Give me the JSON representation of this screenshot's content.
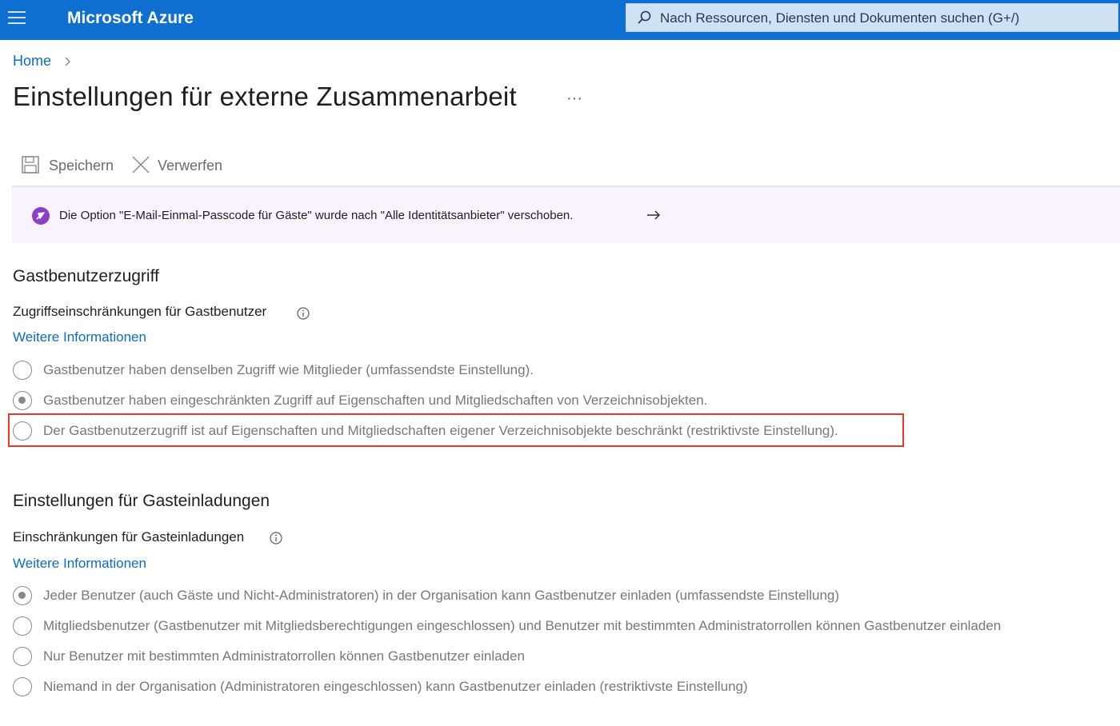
{
  "topbar": {
    "brand": "Microsoft Azure",
    "search_text": "Nach Ressourcen, Diensten und Dokumenten suchen (G+/)",
    "colors": {
      "bar": "#0f6fd0",
      "search_bg": "#cfe2f3"
    }
  },
  "breadcrumb": {
    "home": "Home"
  },
  "page": {
    "title": "Einstellungen für externe Zusammenarbeit",
    "more": "···"
  },
  "toolbar": {
    "save_label": "Speichern",
    "discard_label": "Verwerfen"
  },
  "banner": {
    "text": "Die Option \"E-Mail-Einmal-Passcode für Gäste\" wurde nach \"Alle Identitätsanbieter\" verschoben.",
    "icon": "rocket-icon",
    "colors": {
      "bg": "#f8f3fc",
      "icon": "#8a3fc7"
    }
  },
  "guest_access": {
    "title": "Gastbenutzerzugriff",
    "subheading": "Zugriffseinschränkungen für Gastbenutzer",
    "learn_more": "Weitere Informationen",
    "options": [
      {
        "label": "Gastbenutzer haben denselben Zugriff wie Mitglieder (umfassendste Einstellung).",
        "checked": false
      },
      {
        "label": "Gastbenutzer haben eingeschränkten Zugriff auf Eigenschaften und Mitgliedschaften von Verzeichnisobjekten.",
        "checked": true
      },
      {
        "label": "Der Gastbenutzerzugriff ist auf Eigenschaften und Mitgliedschaften eigener Verzeichnisobjekte beschränkt (restriktivste Einstellung).",
        "checked": false,
        "highlighted": true
      }
    ]
  },
  "guest_invites": {
    "title": "Einstellungen für Gasteinladungen",
    "subheading": "Einschränkungen für Gasteinladungen",
    "learn_more": "Weitere Informationen",
    "options": [
      {
        "label": "Jeder Benutzer (auch Gäste und Nicht-Administratoren) in der Organisation kann Gastbenutzer einladen (umfassendste Einstellung)",
        "checked": true
      },
      {
        "label": "Mitgliedsbenutzer (Gastbenutzer mit Mitgliedsberechtigungen eingeschlossen) und Benutzer mit bestimmten Administratorrollen können Gastbenutzer einladen",
        "checked": false
      },
      {
        "label": "Nur Benutzer mit bestimmten Administratorrollen können Gastbenutzer einladen",
        "checked": false
      },
      {
        "label": "Niemand in der Organisation (Administratoren eingeschlossen) kann Gastbenutzer einladen (restriktivste Einstellung)",
        "checked": false
      }
    ]
  },
  "highlight_color": "#e8362b"
}
